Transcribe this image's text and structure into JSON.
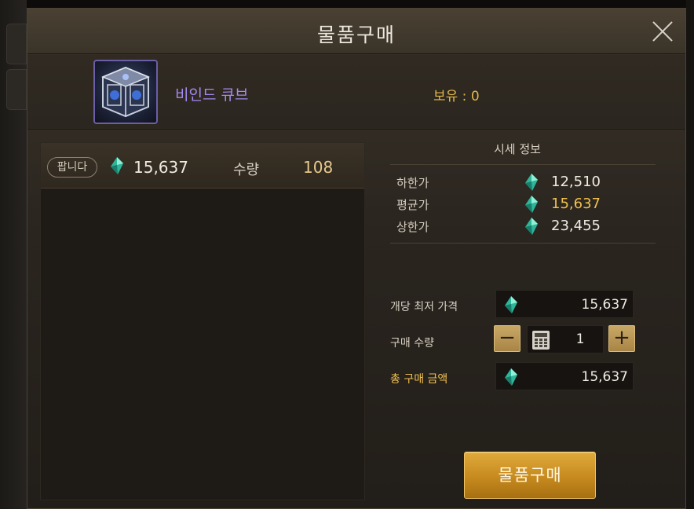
{
  "dialog": {
    "title": "물품구매",
    "close_icon": "close-icon"
  },
  "item": {
    "name": "비인드 큐브",
    "owned": "보유 : 0",
    "icon": "cube-icon",
    "name_color": "#a489f0"
  },
  "listing": {
    "badge": "팝니다",
    "price": "15,637",
    "qty_label": "수량",
    "qty": "108",
    "currency_icon": "gem-icon"
  },
  "market": {
    "title": "시세 정보",
    "rows": [
      {
        "label": "하한가",
        "value": "12,510"
      },
      {
        "label": "평균가",
        "value": "15,637"
      },
      {
        "label": "상한가",
        "value": "23,455"
      }
    ],
    "highlight_color": "#f0c050"
  },
  "purchase": {
    "lowest_price_label": "개당 최저 가격",
    "lowest_price": "15,637",
    "qty_label": "구매 수량",
    "qty": "1",
    "minus_label": "−",
    "plus_label": "+",
    "total_label": "총 구매 금액",
    "total": "15,637",
    "buy_label": "물품구매"
  }
}
